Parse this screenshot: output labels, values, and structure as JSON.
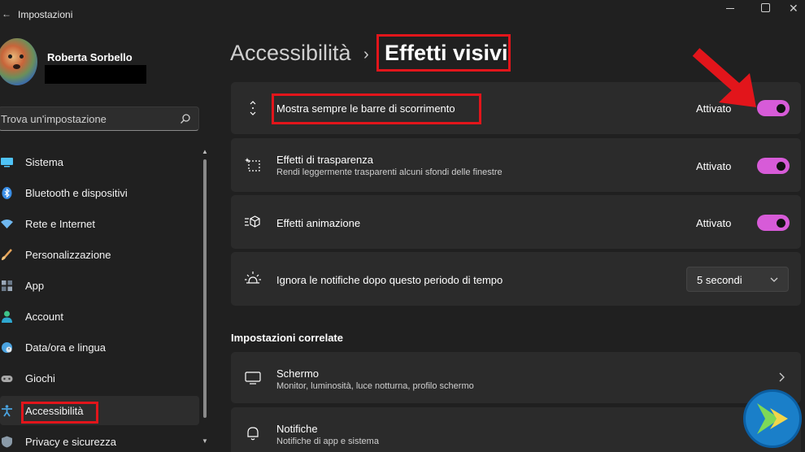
{
  "window": {
    "title": "Impostazioni",
    "back_glyph": "←"
  },
  "profile": {
    "name": "Roberta Sorbello"
  },
  "search": {
    "placeholder": "Trova un'impostazione"
  },
  "sidebar": {
    "items": [
      {
        "label": "Sistema",
        "icon": "monitor-icon",
        "color": "#4fc3f7"
      },
      {
        "label": "Bluetooth e dispositivi",
        "icon": "bluetooth-icon",
        "color": "#3a8ee6"
      },
      {
        "label": "Rete e Internet",
        "icon": "wifi-icon",
        "color": "#6fb8f0"
      },
      {
        "label": "Personalizzazione",
        "icon": "brush-icon",
        "color": "#e6a45a"
      },
      {
        "label": "App",
        "icon": "apps-icon",
        "color": "#9aa8b8"
      },
      {
        "label": "Account",
        "icon": "person-icon",
        "color": "#3ec48a"
      },
      {
        "label": "Data/ora e lingua",
        "icon": "globe-clock-icon",
        "color": "#4aa3e0"
      },
      {
        "label": "Giochi",
        "icon": "gamepad-icon",
        "color": "#a8a8a8"
      },
      {
        "label": "Accessibilità",
        "icon": "accessibility-icon",
        "color": "#4aa3e0",
        "selected": true
      },
      {
        "label": "Privacy e sicurezza",
        "icon": "shield-icon",
        "color": "#8a9aa8"
      }
    ]
  },
  "header": {
    "parent": "Accessibilità",
    "separator": "›",
    "current": "Effetti visivi"
  },
  "settings": [
    {
      "title": "Mostra sempre le barre di scorrimento",
      "subtitle": "",
      "state": "Attivato",
      "on": true,
      "icon": "scroll-arrows-icon"
    },
    {
      "title": "Effetti di trasparenza",
      "subtitle": "Rendi leggermente trasparenti alcuni sfondi delle finestre",
      "state": "Attivato",
      "on": true,
      "icon": "transparency-icon"
    },
    {
      "title": "Effetti animazione",
      "subtitle": "",
      "state": "Attivato",
      "on": true,
      "icon": "animation-icon"
    },
    {
      "title": "Ignora le notifiche dopo questo periodo di tempo",
      "subtitle": "",
      "dropdown_value": "5 secondi",
      "icon": "brightness-icon"
    }
  ],
  "related": {
    "heading": "Impostazioni correlate",
    "items": [
      {
        "title": "Schermo",
        "subtitle": "Monitor, luminosità, luce notturna, profilo schermo",
        "icon": "display-icon"
      },
      {
        "title": "Notifiche",
        "subtitle": "Notifiche di app e sistema",
        "icon": "bell-icon"
      }
    ]
  },
  "colors": {
    "background": "#202020",
    "card": "#2b2b2b",
    "toggle_on": "#d75bd8",
    "annotation": "#e2151b"
  }
}
